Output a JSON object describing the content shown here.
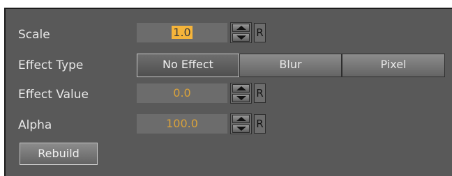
{
  "rows": {
    "scale": {
      "label": "Scale",
      "value": "1.0",
      "reset": "R"
    },
    "effect_type": {
      "label": "Effect Type",
      "options": [
        "No Effect",
        "Blur",
        "Pixel"
      ],
      "selected": "No Effect"
    },
    "effect_value": {
      "label": "Effect Value",
      "value": "0.0",
      "reset": "R"
    },
    "alpha": {
      "label": "Alpha",
      "value": "100.0",
      "reset": "R"
    }
  },
  "rebuild_label": "Rebuild",
  "colors": {
    "panel_bg": "#595959",
    "field_bg": "#6c6c6c",
    "value_text": "#d9a23b",
    "selection": "#f5b43a",
    "label_text": "#e8e8e8"
  }
}
